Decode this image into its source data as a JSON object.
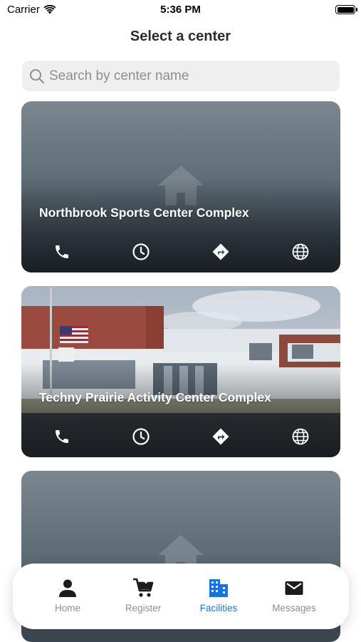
{
  "status_bar": {
    "carrier": "Carrier",
    "time": "5:36 PM"
  },
  "header": {
    "title": "Select a center"
  },
  "search": {
    "placeholder": "Search by center name",
    "value": ""
  },
  "centers": [
    {
      "name": "Northbrook Sports Center Complex",
      "has_photo": false
    },
    {
      "name": "Techny Prairie Activity Center Complex",
      "has_photo": true
    },
    {
      "name": "",
      "has_photo": false
    }
  ],
  "card_actions": [
    "phone-icon",
    "clock-icon",
    "directions-icon",
    "globe-icon"
  ],
  "tabs": [
    {
      "label": "Home",
      "icon": "person-icon",
      "active": false
    },
    {
      "label": "Register",
      "icon": "cart-icon",
      "active": false
    },
    {
      "label": "Facilities",
      "icon": "building-icon",
      "active": true
    },
    {
      "label": "Messages",
      "icon": "envelope-icon",
      "active": false
    }
  ],
  "colors": {
    "accent": "#1a73d9",
    "inactive": "#8e8e93",
    "card": "#5a6872"
  }
}
